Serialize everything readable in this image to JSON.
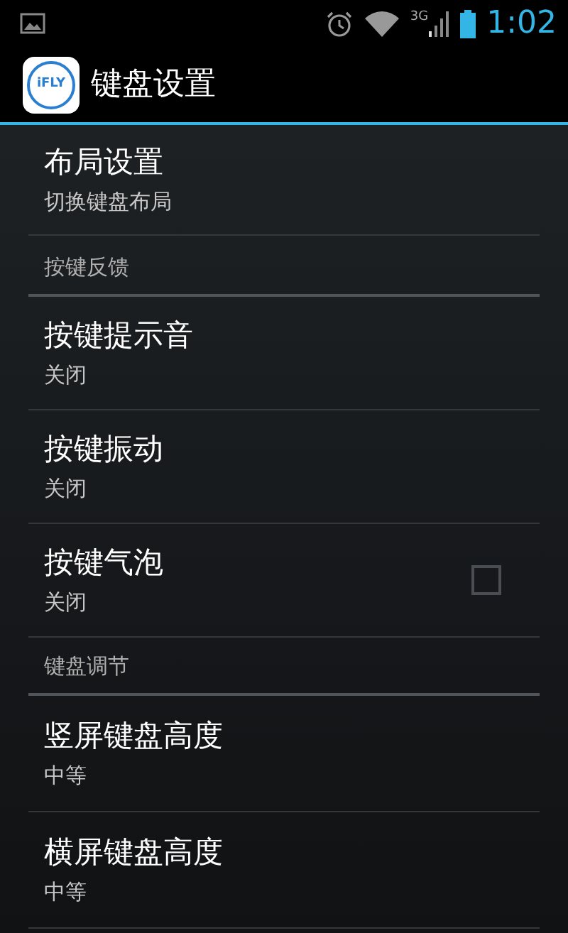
{
  "status_bar": {
    "time": "1:02",
    "network": "3G"
  },
  "action_bar": {
    "logo_text": "iFLY",
    "title": "键盘设置"
  },
  "items": [
    {
      "kind": "item",
      "title": "布局设置",
      "summary": "切换键盘布局"
    },
    {
      "kind": "header",
      "title": "按键反馈"
    },
    {
      "kind": "item",
      "title": "按键提示音",
      "summary": "关闭"
    },
    {
      "kind": "item",
      "title": "按键振动",
      "summary": "关闭"
    },
    {
      "kind": "checkbox",
      "title": "按键气泡",
      "summary": "关闭",
      "checked": false
    },
    {
      "kind": "header",
      "title": "键盘调节"
    },
    {
      "kind": "item",
      "title": "竖屏键盘高度",
      "summary": "中等"
    },
    {
      "kind": "item",
      "title": "横屏键盘高度",
      "summary": "中等"
    }
  ]
}
